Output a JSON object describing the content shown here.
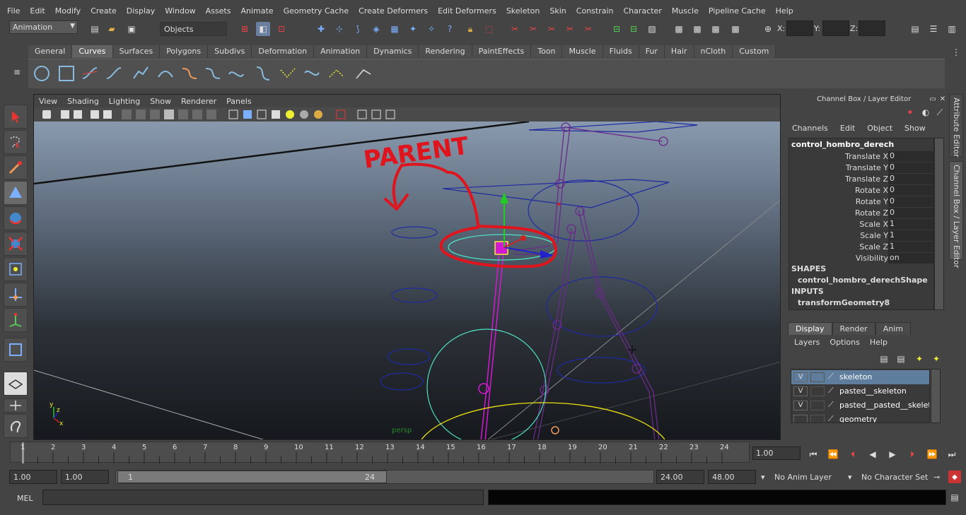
{
  "menubar": [
    "File",
    "Edit",
    "Modify",
    "Create",
    "Display",
    "Window",
    "Assets",
    "Animate",
    "Geometry Cache",
    "Create Deformers",
    "Edit Deformers",
    "Skeleton",
    "Skin",
    "Constrain",
    "Character",
    "Muscle",
    "Pipeline Cache",
    "Help"
  ],
  "statusline": {
    "mode": "Animation",
    "selection_mask": "Objects",
    "x_label": "X:",
    "y_label": "Y:",
    "z_label": "Z:"
  },
  "shelf": {
    "tabs": [
      "General",
      "Curves",
      "Surfaces",
      "Polygons",
      "Subdivs",
      "Deformation",
      "Animation",
      "Dynamics",
      "Rendering",
      "PaintEffects",
      "Toon",
      "Muscle",
      "Fluids",
      "Fur",
      "Hair",
      "nCloth",
      "Custom"
    ],
    "active": "Curves"
  },
  "viewport": {
    "menu": [
      "View",
      "Shading",
      "Lighting",
      "Show",
      "Renderer",
      "Panels"
    ],
    "annotation": "PARENT",
    "axis_x": "x",
    "axis_y": "y",
    "axis_z": "z",
    "overlay_text": "persp"
  },
  "channelbox": {
    "title": "Channel Box / Layer Editor",
    "menu": [
      "Channels",
      "Edit",
      "Object",
      "Show"
    ],
    "node": "control_hombro_derech",
    "channels": [
      {
        "label": "Translate X",
        "value": "0"
      },
      {
        "label": "Translate Y",
        "value": "0"
      },
      {
        "label": "Translate Z",
        "value": "0"
      },
      {
        "label": "Rotate X",
        "value": "0"
      },
      {
        "label": "Rotate Y",
        "value": "0"
      },
      {
        "label": "Rotate Z",
        "value": "0"
      },
      {
        "label": "Scale X",
        "value": "1"
      },
      {
        "label": "Scale Y",
        "value": "1"
      },
      {
        "label": "Scale Z",
        "value": "1"
      },
      {
        "label": "Visibility",
        "value": "on"
      }
    ],
    "shapes_header": "SHAPES",
    "shape": "control_hombro_derechShape",
    "inputs_header": "INPUTS",
    "input": "transformGeometry8"
  },
  "side_tabs": [
    "Attribute Editor",
    "Channel Box / Layer Editor"
  ],
  "layers": {
    "tabs": [
      "Display",
      "Render",
      "Anim"
    ],
    "active_tab": "Display",
    "menu": [
      "Layers",
      "Options",
      "Help"
    ],
    "rows": [
      {
        "vis": "V",
        "name": "skeleton",
        "selected": true
      },
      {
        "vis": "V",
        "name": "pasted__skeleton",
        "selected": false
      },
      {
        "vis": "V",
        "name": "pasted__pasted__skeleton",
        "selected": false
      },
      {
        "vis": "",
        "name": "geometry",
        "selected": false
      }
    ]
  },
  "timeline": {
    "ticks": [
      "1",
      "2",
      "3",
      "4",
      "5",
      "6",
      "7",
      "8",
      "9",
      "10",
      "11",
      "12",
      "13",
      "14",
      "15",
      "16",
      "17",
      "18",
      "19",
      "20",
      "21",
      "22",
      "23",
      "24"
    ],
    "current_frame": "1.00"
  },
  "range": {
    "start": "1.00",
    "playback_start": "1.00",
    "handle_start": "1",
    "handle_end": "24",
    "playback_end": "24.00",
    "end": "48.00",
    "anim_layer": "No Anim Layer",
    "character_set": "No Character Set"
  },
  "cmdline": {
    "label": "MEL"
  },
  "colors": {
    "annotation_red": "#e0141c",
    "joint_purple": "#6a2a8a",
    "selected_magenta": "#d21ad2",
    "nurbs_blue": "#1e2aa0",
    "highlight_cyan": "#4fe0c0",
    "curve_yellow": "#e8e010"
  }
}
